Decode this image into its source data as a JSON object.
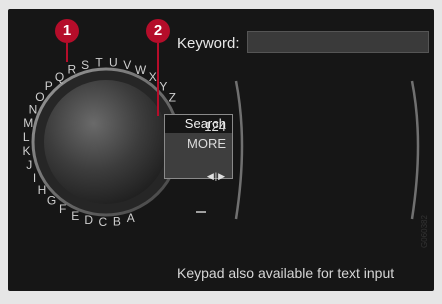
{
  "keyword": {
    "label": "Keyword:"
  },
  "dial": {
    "letters": [
      "A",
      "B",
      "C",
      "D",
      "E",
      "F",
      "G",
      "H",
      "I",
      "J",
      "K",
      "L",
      "M",
      "N",
      "O",
      "P",
      "Q",
      "R",
      "S",
      "T",
      "U",
      "V",
      "W",
      "X",
      "Y",
      "Z"
    ]
  },
  "popup_menu": {
    "items": [
      "124",
      "MORE",
      "Search"
    ],
    "arrows": "◀|▶"
  },
  "footer": {
    "text": "Keypad also available for text input"
  },
  "callouts": [
    "1",
    "2"
  ],
  "image_code": "G060382",
  "colors": {
    "callout": "#b50d2a",
    "screen_bg": "#161616"
  }
}
